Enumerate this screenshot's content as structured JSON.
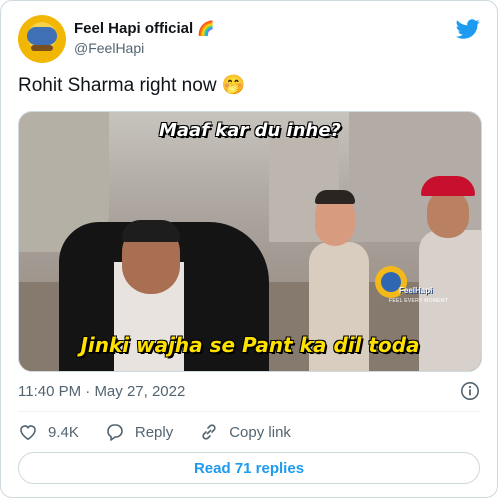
{
  "author": {
    "display_name": "Feel Hapi official",
    "name_emoji": "🌈",
    "handle": "@FeelHapi"
  },
  "tweet": {
    "text": "Rohit Sharma right now",
    "text_emoji": "🤭"
  },
  "media": {
    "caption_top": "Maaf kar du inhe?",
    "caption_bottom": "Jinki wajha se Pant ka dil toda",
    "watermark_name": "FeelHapi",
    "watermark_sub": "FEEL EVERY MOMENT"
  },
  "meta": {
    "time": "11:40 PM",
    "separator": "·",
    "date": "May 27, 2022"
  },
  "actions": {
    "likes": "9.4K",
    "reply_label": "Reply",
    "copy_link_label": "Copy link"
  },
  "replies_button": "Read 71 replies",
  "colors": {
    "accent": "#1d9bf0",
    "secondary_text": "#536471",
    "caption_yellow": "#ffe100"
  },
  "icons": {
    "brand": "twitter-bird-icon",
    "info": "info-icon",
    "like": "heart-icon",
    "reply": "reply-bubble-icon",
    "copy": "link-icon"
  }
}
